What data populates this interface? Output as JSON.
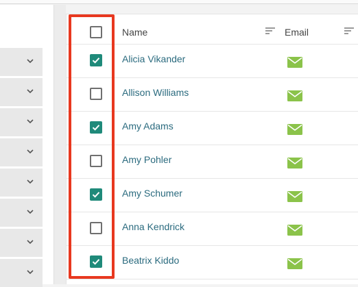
{
  "columns": {
    "name_label": "Name",
    "email_label": "Email"
  },
  "filter_rows": 8,
  "contacts": [
    {
      "name": "Alicia Vikander",
      "checked": true
    },
    {
      "name": "Allison Williams",
      "checked": false
    },
    {
      "name": "Amy Adams",
      "checked": true
    },
    {
      "name": "Amy Pohler",
      "checked": false
    },
    {
      "name": "Amy Schumer",
      "checked": true
    },
    {
      "name": "Anna Kendrick",
      "checked": false
    },
    {
      "name": "Beatrix Kiddo",
      "checked": true
    }
  ],
  "colors": {
    "checkbox_checked": "#1f8a7a",
    "name_link": "#2a6a7e",
    "mail_icon": "#8bc34a",
    "highlight_border": "#e8381f"
  },
  "icons": {
    "filter_chevron": "chevron-down-icon",
    "sort": "sort-icon",
    "email": "mail-icon",
    "check": "check-icon"
  }
}
